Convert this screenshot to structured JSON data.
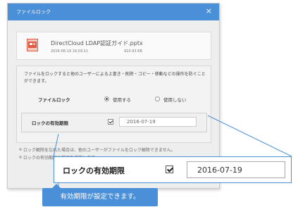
{
  "dialog": {
    "title": "ファイルロック",
    "close_glyph": "×",
    "file": {
      "name": "DirectCloud LDAP認証ガイド.pptx",
      "date": "2016-06-19 16:03:11",
      "size": "910.93 KB",
      "icon": "pptx-file-icon"
    },
    "description": "ファイルをロックすると他のユーザーによる上書き・削除・コピー・移動などの操作を防ぐことができます。",
    "lock": {
      "label": "ファイルロック",
      "use_label": "使用する",
      "no_use_label": "使用しない",
      "selected": "使用する"
    },
    "expiry": {
      "label": "ロックの有効期限",
      "checked": true,
      "date": "2016-07-19"
    },
    "notes": [
      "ロック解除を忘れた場合は、他のユーザーがファイルをロック解除できません。",
      "ロックの有効期限の設定を推奨します。"
    ]
  },
  "zoom": {
    "label": "ロックの有効期限",
    "checked": true,
    "date": "2016-07-19"
  },
  "callout": {
    "text": "有効期限が設定できます。"
  },
  "colors": {
    "accent": "#4a90d9",
    "dialog_bg": "#eeeeee"
  }
}
